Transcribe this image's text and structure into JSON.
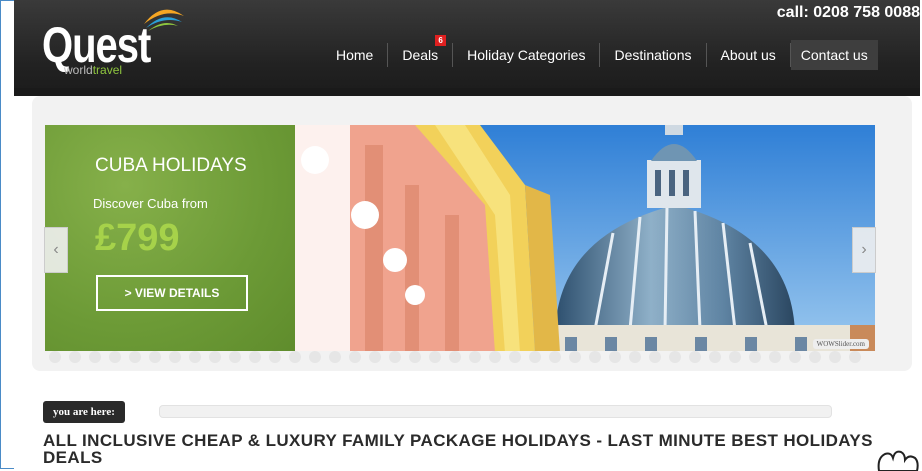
{
  "header": {
    "logo_text": "Quest",
    "logo_sub_world": "world",
    "logo_sub_travel": "travel",
    "phone": "call: 0208 758 0088"
  },
  "nav": {
    "items": [
      {
        "label": "Home"
      },
      {
        "label": "Deals",
        "badge": "6"
      },
      {
        "label": "Holiday Categories"
      },
      {
        "label": "Destinations"
      },
      {
        "label": "About us"
      },
      {
        "label": "Contact us"
      }
    ]
  },
  "slider": {
    "title": "CUBA HOLIDAYS",
    "discover": "Discover Cuba from",
    "price": "£799",
    "button": "> VIEW DETAILS",
    "watermark": "WOWSlider.com",
    "prev_icon": "chevron-left-icon",
    "next_icon": "chevron-right-icon"
  },
  "breadcrumb": {
    "label": "you are here:"
  },
  "headline": "ALL INCLUSIVE CHEAP & LUXURY FAMILY PACKAGE HOLIDAYS - LAST MINUTE BEST HOLIDAYS DEALS",
  "colors": {
    "header_bg": "#2b2b2b",
    "green_panel": "#6c9a36",
    "price_green": "#a6d24a",
    "badge_red": "#e02020"
  }
}
